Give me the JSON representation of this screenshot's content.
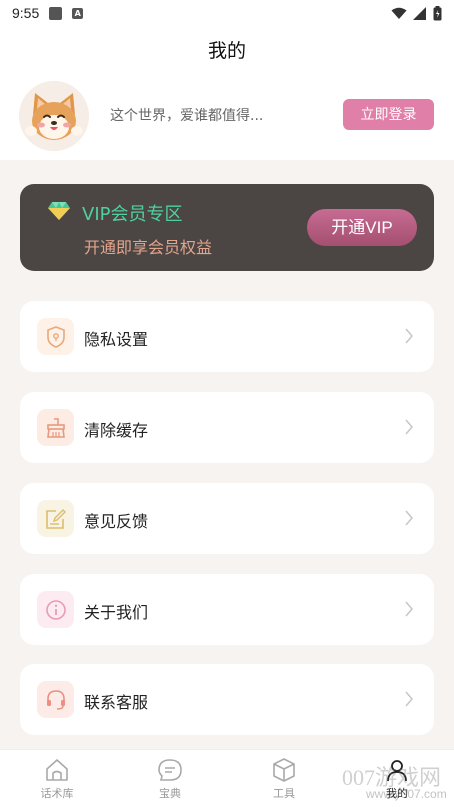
{
  "status_bar": {
    "time": "9:55"
  },
  "header": {
    "title": "我的",
    "slogan": "这个世界，爱谁都值得...",
    "login_label": "立即登录"
  },
  "vip": {
    "title": "VIP会员专区",
    "subtitle": "开通即享会员权益",
    "button_label": "开通VIP",
    "accent_color": "#4fd0a0",
    "button_color": "#b95c84"
  },
  "menu": [
    {
      "label": "隐私设置",
      "icon": "shield-icon"
    },
    {
      "label": "清除缓存",
      "icon": "broom-icon"
    },
    {
      "label": "意见反馈",
      "icon": "edit-icon"
    },
    {
      "label": "关于我们",
      "icon": "info-icon"
    },
    {
      "label": "联系客服",
      "icon": "headset-icon"
    }
  ],
  "bottom_nav": [
    {
      "label": "话术库",
      "icon": "home-icon",
      "active": false
    },
    {
      "label": "宝典",
      "icon": "chat-icon",
      "active": false
    },
    {
      "label": "工具",
      "icon": "cube-icon",
      "active": false
    },
    {
      "label": "我的",
      "icon": "user-icon",
      "active": true
    }
  ],
  "watermark": {
    "text": "007游戏网",
    "url": "www.y007.com"
  },
  "colors": {
    "brand_pink": "#e07fa8",
    "background": "#f7f3f0"
  }
}
